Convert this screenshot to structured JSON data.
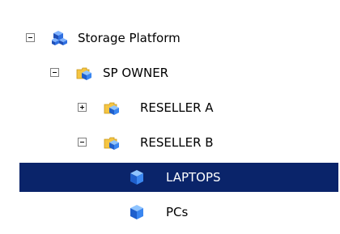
{
  "tree": {
    "nodes": [
      {
        "label": "Storage Platform",
        "expanded": true,
        "selected": false,
        "icon": "network-cubes-icon"
      },
      {
        "label": "SP OWNER",
        "expanded": true,
        "selected": false,
        "icon": "folder-cube-icon"
      },
      {
        "label": "RESELLER A",
        "expanded": false,
        "selected": false,
        "icon": "folder-cube-icon"
      },
      {
        "label": "RESELLER B",
        "expanded": true,
        "selected": false,
        "icon": "folder-cube-icon"
      },
      {
        "label": "LAPTOPS",
        "expanded": null,
        "selected": true,
        "icon": "blue-cube-icon"
      },
      {
        "label": "PCs",
        "expanded": null,
        "selected": false,
        "icon": "blue-cube-icon"
      }
    ]
  },
  "colors": {
    "selection": "#0a246a",
    "selection_text": "#ffffff",
    "cube_blue": "#1f6fe0",
    "folder_yellow": "#f5c542"
  }
}
